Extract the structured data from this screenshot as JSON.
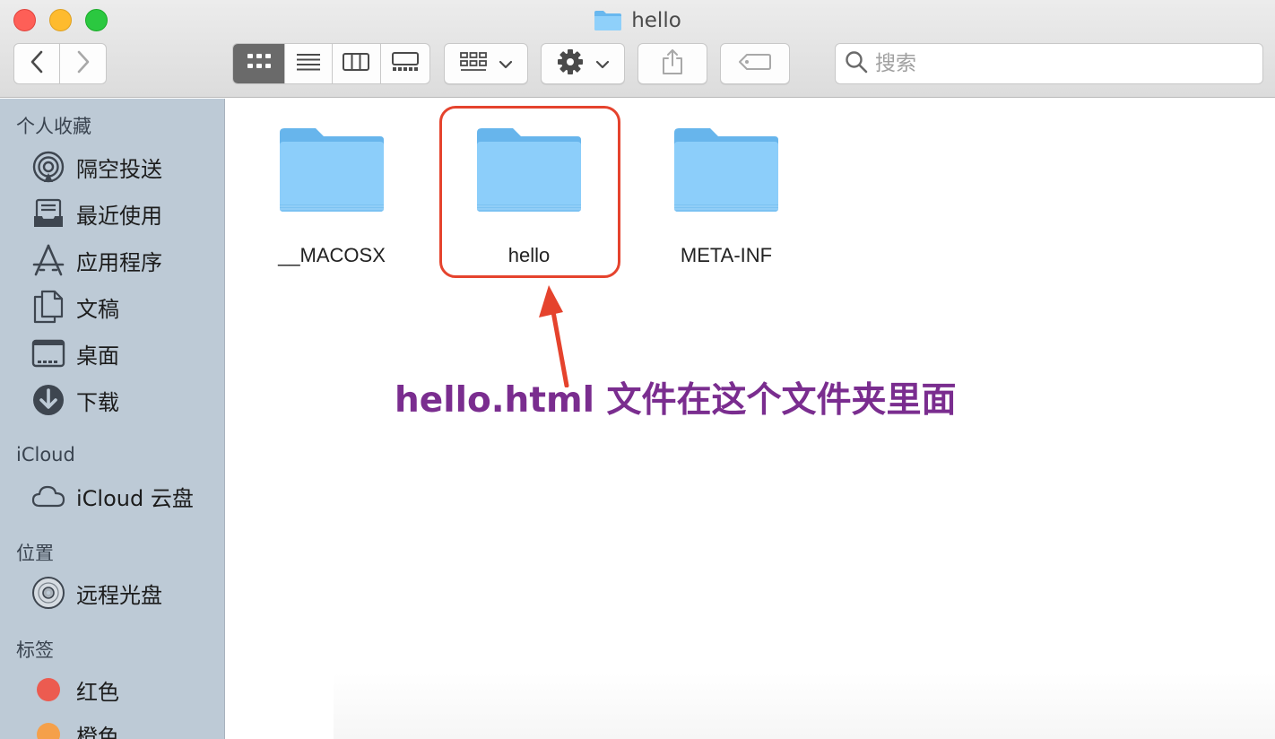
{
  "window": {
    "title": "hello",
    "title_icon": "folder-icon"
  },
  "toolbar": {
    "back_icon": "chevron-left-icon",
    "forward_icon": "chevron-right-icon",
    "view_modes": [
      "icon-view-icon",
      "list-view-icon",
      "column-view-icon",
      "gallery-view-icon"
    ],
    "active_view": "icon-view-icon",
    "group_icon": "group-by-icon",
    "action_icon": "gear-icon",
    "share_icon": "share-icon",
    "tag_icon": "tag-icon",
    "search_placeholder": "搜索"
  },
  "sidebar": {
    "favorites_title": "个人收藏",
    "favorites": [
      {
        "label": "隔空投送",
        "icon": "airdrop-icon"
      },
      {
        "label": "最近使用",
        "icon": "recents-icon"
      },
      {
        "label": "应用程序",
        "icon": "applications-icon"
      },
      {
        "label": "文稿",
        "icon": "documents-icon"
      },
      {
        "label": "桌面",
        "icon": "desktop-icon"
      },
      {
        "label": "下载",
        "icon": "downloads-icon"
      }
    ],
    "icloud_title": "iCloud",
    "icloud": [
      {
        "label": "iCloud 云盘",
        "icon": "cloud-icon"
      }
    ],
    "locations_title": "位置",
    "locations": [
      {
        "label": "远程光盘",
        "icon": "disc-icon"
      }
    ],
    "tags_title": "标签",
    "tags": [
      {
        "label": "红色",
        "color": "#ec5b50"
      },
      {
        "label": "橙色",
        "color": "#f5a04a"
      }
    ]
  },
  "files": [
    {
      "name": "__MACOSX",
      "icon": "folder-icon"
    },
    {
      "name": "hello",
      "icon": "folder-icon"
    },
    {
      "name": "META-INF",
      "icon": "folder-icon"
    }
  ],
  "annotation": {
    "text": "hello.html 文件在这个文件夹里面",
    "color": "#7a2d8f",
    "arrow_color": "#e5432d"
  }
}
